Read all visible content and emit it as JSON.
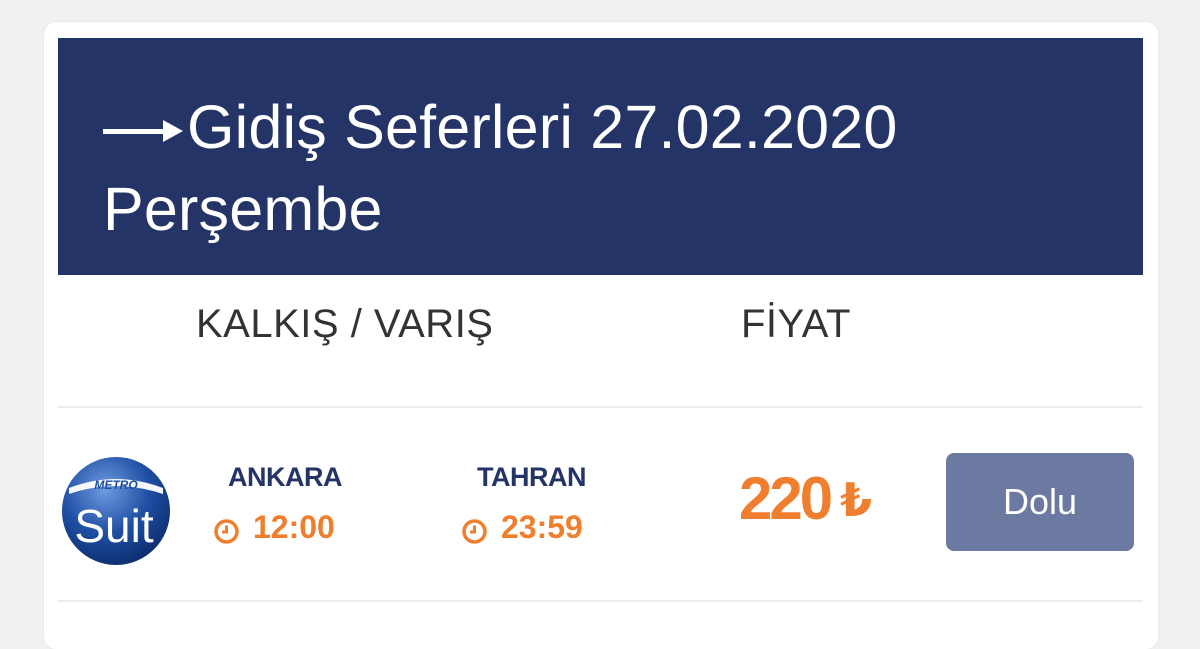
{
  "header": {
    "title": "Gidiş Seferleri 27.02.2020 Perşembe",
    "arrow_icon": "right-arrow-icon",
    "background_color": "#253467"
  },
  "columns": {
    "departure_arrival": "KALKIŞ / VARIŞ",
    "price": "FİYAT"
  },
  "trip": {
    "operator_logo": {
      "top_text": "METRO",
      "main_text": "Suit"
    },
    "departure": {
      "city": "ANKARA",
      "time": "12:00"
    },
    "arrival": {
      "city": "TAHRAN",
      "time": "23:59"
    },
    "price": {
      "amount": "220",
      "currency": "₺"
    },
    "status_button": "Dolu"
  },
  "colors": {
    "accent_orange": "#ef7f2e",
    "navy": "#253467",
    "button_disabled": "#6c7aa2"
  },
  "icons": {
    "clock": "clock-icon"
  }
}
